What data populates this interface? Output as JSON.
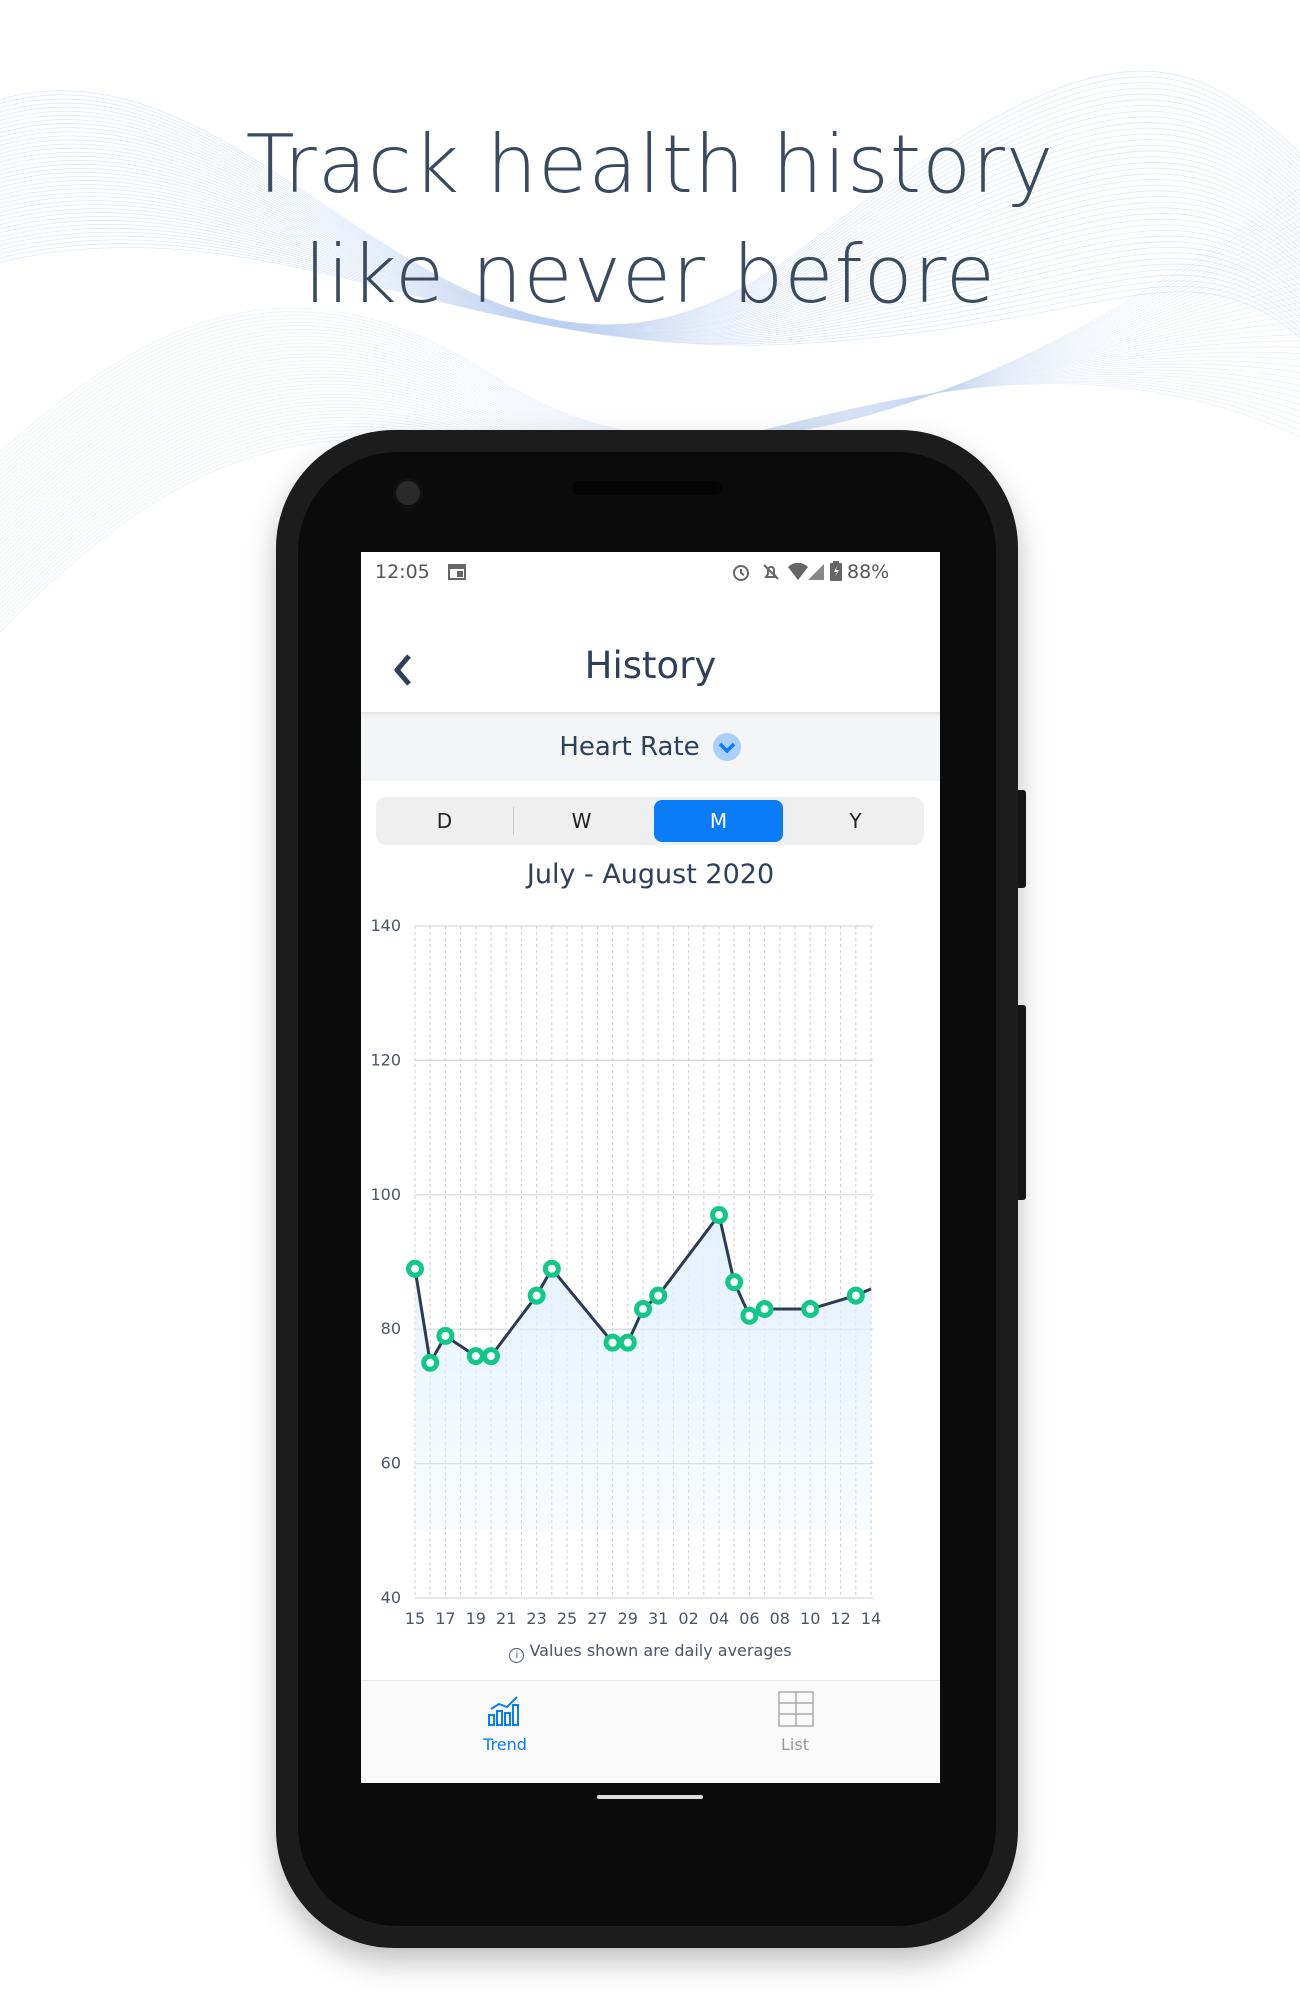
{
  "headline": {
    "line1": "Track health history",
    "line2": "like never before"
  },
  "status_bar": {
    "time": "12:05",
    "battery": "88%",
    "icons": [
      "calendar-icon",
      "alarm-icon",
      "bell-off-icon",
      "wifi-icon",
      "signal-icon",
      "battery-charging-icon"
    ]
  },
  "header": {
    "title": "History",
    "back_icon": "chevron-left-icon"
  },
  "metric_selector": {
    "value": "Heart Rate",
    "icon": "chevron-down-icon"
  },
  "period_tabs": [
    {
      "label": "D",
      "active": false
    },
    {
      "label": "W",
      "active": false
    },
    {
      "label": "M",
      "active": true
    },
    {
      "label": "Y",
      "active": false
    }
  ],
  "date_range": "July - August 2020",
  "colors": {
    "accent": "#0a7cf8",
    "line": "#2d3b55",
    "marker": "#12c889",
    "area": "#e3f1fd",
    "text": "#2f3f5a"
  },
  "chart_data": {
    "type": "line",
    "title": "",
    "xlabel": "",
    "ylabel": "",
    "ylim": [
      40,
      140
    ],
    "xlim": [
      "2020-07-15",
      "2020-08-14"
    ],
    "yticks": [
      "40",
      "60",
      "80",
      "100",
      "120",
      "140"
    ],
    "xticks": [
      "15",
      "17",
      "19",
      "21",
      "23",
      "25",
      "27",
      "29",
      "31",
      "02",
      "04",
      "06",
      "08",
      "10",
      "12",
      "14"
    ],
    "grid": {
      "horizontal": true,
      "vertical": "dashed"
    },
    "area_fill": true,
    "points": [
      {
        "x": "2020-07-15",
        "y": 89
      },
      {
        "x": "2020-07-16",
        "y": 75
      },
      {
        "x": "2020-07-17",
        "y": 79
      },
      {
        "x": "2020-07-19",
        "y": 76
      },
      {
        "x": "2020-07-20",
        "y": 76
      },
      {
        "x": "2020-07-23",
        "y": 85
      },
      {
        "x": "2020-07-24",
        "y": 89
      },
      {
        "x": "2020-07-28",
        "y": 78
      },
      {
        "x": "2020-07-29",
        "y": 78
      },
      {
        "x": "2020-07-30",
        "y": 83
      },
      {
        "x": "2020-07-31",
        "y": 85
      },
      {
        "x": "2020-08-04",
        "y": 97
      },
      {
        "x": "2020-08-05",
        "y": 87
      },
      {
        "x": "2020-08-06",
        "y": 82
      },
      {
        "x": "2020-08-07",
        "y": 83
      },
      {
        "x": "2020-08-10",
        "y": 83
      },
      {
        "x": "2020-08-13",
        "y": 85
      },
      {
        "x": "2020-08-14",
        "y": 86
      }
    ]
  },
  "footnote": {
    "icon": "info-icon",
    "text": "Values shown are daily averages"
  },
  "bottom_nav": [
    {
      "label": "Trend",
      "icon": "trend-chart-icon",
      "active": true
    },
    {
      "label": "List",
      "icon": "table-grid-icon",
      "active": false
    }
  ]
}
